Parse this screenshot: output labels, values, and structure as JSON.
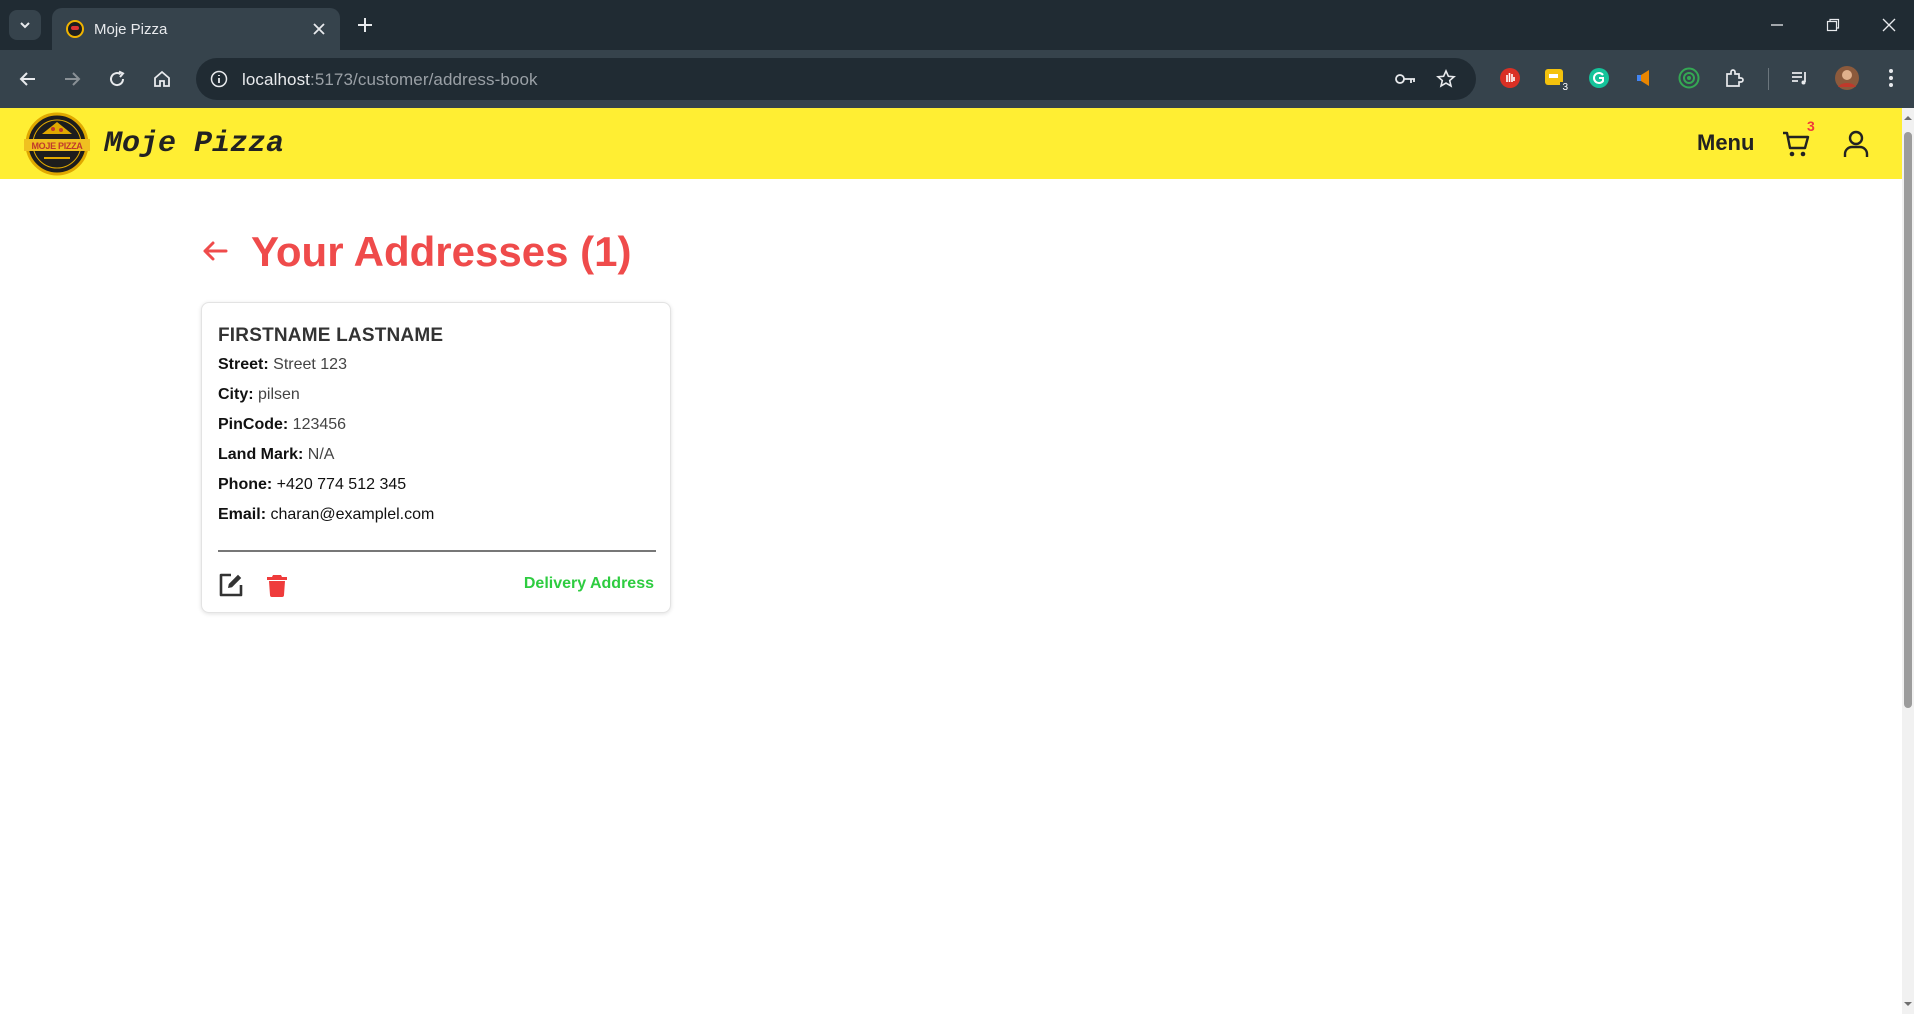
{
  "browser": {
    "tab_title": "Moje Pizza",
    "url_host": "localhost",
    "url_path": ":5173/customer/address-book",
    "extensions": [
      "hand-stop-icon",
      "badge-extension-icon",
      "grammarly-icon",
      "megaphone-icon",
      "circle-target-icon",
      "puzzle-icon"
    ],
    "extension_badge": "3"
  },
  "header": {
    "logo_text": "MOJE PIZZA",
    "brand": "Moje Pizza",
    "menu_label": "Menu",
    "cart_count": "3",
    "background": "#ffee33"
  },
  "page": {
    "title": "Your Addresses (1)",
    "accent": "#ef4b4b"
  },
  "addresses": [
    {
      "name": "FIRSTNAME LASTNAME",
      "street_label": "Street:",
      "street": "Street 123",
      "city_label": "City:",
      "city": "pilsen",
      "pincode_label": "PinCode:",
      "pincode": "123456",
      "landmark_label": "Land Mark:",
      "landmark": "N/A",
      "phone_label": "Phone:",
      "phone": "+420 774 512 345",
      "email_label": "Email:",
      "email": "charan@examplel.com",
      "tag": "Delivery Address",
      "tag_color": "#2ecc40"
    }
  ]
}
